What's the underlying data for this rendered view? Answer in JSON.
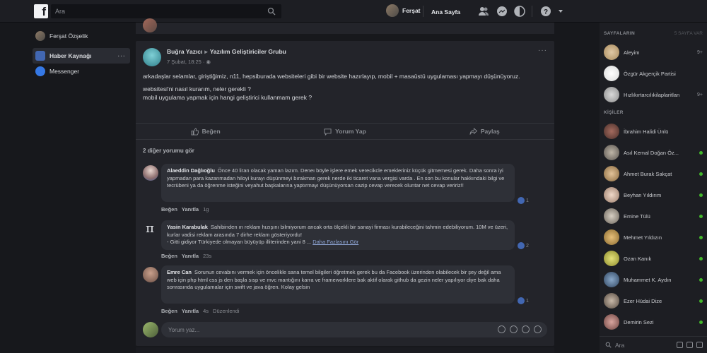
{
  "topbar": {
    "search_placeholder": "Ara",
    "user_name": "Ferşat",
    "home_label": "Ana Sayfa"
  },
  "leftnav": {
    "profile_name": "Ferşat Özşelik",
    "items": [
      {
        "label": "Haber Kaynağı",
        "active": true
      },
      {
        "label": "Messenger",
        "active": false
      }
    ]
  },
  "post": {
    "author": "Buğra Yazıcı",
    "group": "Yazılım Geliştiriciler Grubu",
    "meta": "7 Şubat, 18:25 ·",
    "paragraphs": [
      "arkadaşlar selamlar, giriştiğimiz, n11, hepsiburada websiteleri gibi bir website hazırlayıp, mobil + masaüstü uygulaması yapmayı düşünüyoruz.",
      "websitesi'ni nasıl kurarım, neler gerekli ?",
      "mobil uygulama yapmak için hangi geliştirici kullanmam gerek ?"
    ],
    "actions": [
      "Beğen",
      "Yorum Yap",
      "Paylaş"
    ],
    "more_comments": "2 diğer yorumu gör"
  },
  "comments": [
    {
      "name": "Alaeddin Dağlıoğlu",
      "text": "Önce 40 liran olacak yaman lazım. Deneı böyle işlere emek verecikcle emekleriniz küçük gitmemesi gerek. Daha sonra iyi yapmadan para kazanmadan hiloyi kurayı düşünmeyi bırakman gerek nerde iki ticaret vana vergisi varda . En son bu konular hakkındaki bilgi ve tecrübeni ya da öğrenme isteğini veyahut başkalarına yaptırmayı düşünüyorsan cazip cevap verecek oluntar net cevap veririz!!",
      "like": "Beğen",
      "reply": "Yanıtla",
      "time": "1g",
      "reactions": "1"
    },
    {
      "name": "Yasin Karabulak",
      "text": "Sahibinden ın reklam hızışını bilmiyorum ancak orta ölçekli bir sanayi firması kurabileceğini tahmin edebiliyorum. 10M ve üzeri, kurlar vadisi reklam arasında 7 dirhe reklam gösteriyordu!",
      "text2": "- Gitti gidiyor Türkiyede olmayan büyüyüp illiterinden yani 8 ... ",
      "link": "Daha Fazlasını Gör",
      "like": "Beğen",
      "reply": "Yanıtla",
      "time": "23s",
      "reactions": "2"
    },
    {
      "name": "Emre Can",
      "text": "Sorunun cevabını vermek için öncelikle sana temel bilgileri öğretmek gerek bu da Facebook üzerinden olabilecek bir şey değil ama web için php html css js den başla sısp ve mvc mantığını karra ve frameworklere bak aktif olarak github da gezin neler yapılıyor diye bak daha sonrasında uygulamalar için swift ve java öğren. Kolay gelsin",
      "like": "Beğen",
      "reply": "Yanıtla",
      "time": "4s",
      "edit": "Düzenlendi",
      "reactions": "1"
    }
  ],
  "write_placeholder": "Yorum yaz...",
  "right": {
    "pages_title": "SAYFALARIN",
    "pages_extra": "5 SAYFA VAR",
    "pages": [
      {
        "name": "Aleyim",
        "badge": "9+"
      },
      {
        "name": "Özgür Akgerçik Partisi",
        "badge": ""
      },
      {
        "name": "Hızlıkırtarcılıkilaplaritlan",
        "badge": "9+"
      }
    ],
    "contacts_title": "KİŞİLER",
    "contacts": [
      {
        "name": "İbrahim Halidi Ünlü",
        "online": false
      },
      {
        "name": "Asıl Kemal Doğan Öz...",
        "online": true
      },
      {
        "name": "Ahmet Burak Sakçat",
        "online": true
      },
      {
        "name": "Beyhan Yıldırım",
        "online": true
      },
      {
        "name": "Emine Tülü",
        "online": true
      },
      {
        "name": "Mehmet Yıldızın",
        "online": true
      },
      {
        "name": "Ozan Kanık",
        "online": true
      },
      {
        "name": "Muhammet K. Aydın",
        "online": true
      },
      {
        "name": "Ezer Hüdai Dize",
        "online": true
      },
      {
        "name": "Demirin Sezi",
        "online": true
      }
    ],
    "search_placeholder": "Ara"
  }
}
